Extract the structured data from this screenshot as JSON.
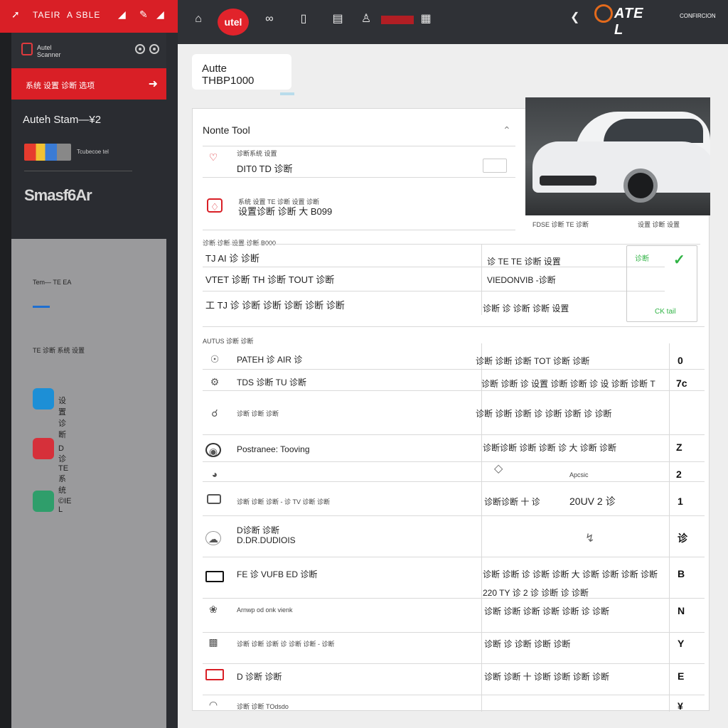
{
  "sidebar": {
    "top_label": "TAEIR",
    "top_label2": "A SBLE",
    "app_name": "Autel\nScanner",
    "red_item": "系统 设置 诊断 选项",
    "title": "Auteh Stam—¥2",
    "brand_text": "Tcubecoe tel",
    "brand2": "Smasf6Ar",
    "mini_label": "Tem— TE EA",
    "mini_label2": "TE 诊断 系统 设置",
    "items": [
      {
        "label": "设置 诊断",
        "color": "#1d8fd6"
      },
      {
        "label": "D诊 TE 系统",
        "color": "#d6303a"
      },
      {
        "label": "©IE L",
        "color": "#2f9e6b"
      }
    ]
  },
  "topbar": {
    "home_icon": "home-icon",
    "pill_label": "utel",
    "brand_word": "ATE  L",
    "brand_sub": "CONFIRCION"
  },
  "main": {
    "tab_label": "Autte THBP1000",
    "section_title": "Nonte Tool",
    "top_rows": [
      {
        "small": "诊断系统 设置",
        "text": "DIT0 TD 诊断"
      },
      {
        "small": "系统 设置 TE  诊断 设置 诊断",
        "text": "设置诊断 诊断 大 B099"
      }
    ],
    "car_caption_left": "FDSE 诊断 TE 诊断",
    "car_caption_right": "设置 诊断 设置",
    "section2_label": "诊断 诊断 设置 诊断 B000",
    "section2_rows": [
      {
        "left": "TJ AI 诊 诊断",
        "right": "诊 TE TE 诊断 设置"
      },
      {
        "left": "VTET 诊断 TH 诊断 TOUT 诊断",
        "right": "VIEDONVIB -诊断"
      },
      {
        "left": "工 TJ 诊 诊断 诊断 诊断 诊断 诊断",
        "right": "诊断 诊 诊断 诊断 设置"
      }
    ],
    "green_small": "诊断",
    "green_small2": "CK tail",
    "section3_label": "AUTUS 诊断 诊断",
    "list_rows": [
      {
        "left": "PATEH 诊 AIR 诊",
        "right": "诊断 诊断 诊断 TOT 诊断 诊断",
        "letter": "0"
      },
      {
        "left": "TDS 诊断 TU 诊断",
        "right": "诊断 诊断 诊 设置 诊断 诊断 诊 设 诊断 诊断 T",
        "letter": "7c"
      },
      {
        "left": "诊断 诊断 诊断",
        "right": "诊断 诊断 诊断 诊 诊断 诊断 诊 诊断",
        "letter": ""
      },
      {
        "left": "Postranee: Tooving",
        "right": "诊断诊断 诊断 诊断 诊 大 诊断 诊断",
        "letter": "Z"
      },
      {
        "left": "",
        "right": "Apcsic",
        "letter": "2"
      },
      {
        "left": "诊断 诊断 诊断 - 诊 TV 诊断 诊断",
        "right": "诊断诊断 十 诊",
        "value": "20UV 2 诊",
        "letter": "1"
      },
      {
        "left": "D诊断 诊断",
        "left2": "D.DR.DUDIOIS",
        "right": "",
        "letter": "诊"
      },
      {
        "left": "FE 诊 VUFB ED 诊断",
        "right": "诊断 诊断 诊 诊断 诊断 大 诊断 诊断 诊断 诊断",
        "right2": "220 TY 诊 2 诊 诊断 诊 诊断",
        "letter": "B"
      },
      {
        "left": "Arnwp od onk vienk",
        "right": "诊断 诊断 诊断 诊断 诊断 诊 诊断",
        "letter": "N"
      },
      {
        "left": "诊断 诊断 诊断 诊 诊断 诊断 - 诊断",
        "right": "诊断 诊 诊断 诊断 诊断",
        "letter": "Y"
      },
      {
        "left": "D 诊断 诊断",
        "right": "诊断 诊断 十 诊断 诊断 诊断 诊断",
        "letter": "E"
      },
      {
        "left": "诊断 诊断 TOdsdo",
        "right": "",
        "letter": "¥"
      }
    ]
  },
  "colors": {
    "accent": "#d91f26",
    "sidebar_dark": "#2a2c31",
    "sidebar_grey": "#9a9a9c",
    "green": "#2fb344"
  }
}
